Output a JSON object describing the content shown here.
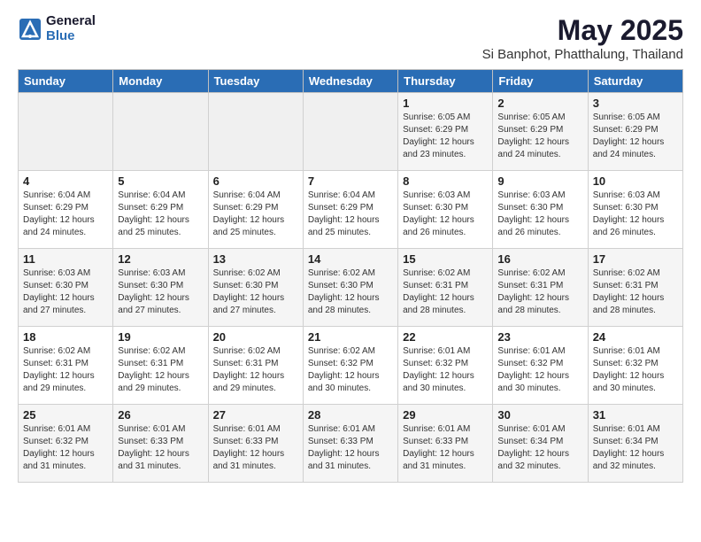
{
  "header": {
    "logo_general": "General",
    "logo_blue": "Blue",
    "month_year": "May 2025",
    "location": "Si Banphot, Phatthalung, Thailand"
  },
  "weekdays": [
    "Sunday",
    "Monday",
    "Tuesday",
    "Wednesday",
    "Thursday",
    "Friday",
    "Saturday"
  ],
  "weeks": [
    [
      {
        "num": "",
        "info": ""
      },
      {
        "num": "",
        "info": ""
      },
      {
        "num": "",
        "info": ""
      },
      {
        "num": "",
        "info": ""
      },
      {
        "num": "1",
        "info": "Sunrise: 6:05 AM\nSunset: 6:29 PM\nDaylight: 12 hours\nand 23 minutes."
      },
      {
        "num": "2",
        "info": "Sunrise: 6:05 AM\nSunset: 6:29 PM\nDaylight: 12 hours\nand 24 minutes."
      },
      {
        "num": "3",
        "info": "Sunrise: 6:05 AM\nSunset: 6:29 PM\nDaylight: 12 hours\nand 24 minutes."
      }
    ],
    [
      {
        "num": "4",
        "info": "Sunrise: 6:04 AM\nSunset: 6:29 PM\nDaylight: 12 hours\nand 24 minutes."
      },
      {
        "num": "5",
        "info": "Sunrise: 6:04 AM\nSunset: 6:29 PM\nDaylight: 12 hours\nand 25 minutes."
      },
      {
        "num": "6",
        "info": "Sunrise: 6:04 AM\nSunset: 6:29 PM\nDaylight: 12 hours\nand 25 minutes."
      },
      {
        "num": "7",
        "info": "Sunrise: 6:04 AM\nSunset: 6:29 PM\nDaylight: 12 hours\nand 25 minutes."
      },
      {
        "num": "8",
        "info": "Sunrise: 6:03 AM\nSunset: 6:30 PM\nDaylight: 12 hours\nand 26 minutes."
      },
      {
        "num": "9",
        "info": "Sunrise: 6:03 AM\nSunset: 6:30 PM\nDaylight: 12 hours\nand 26 minutes."
      },
      {
        "num": "10",
        "info": "Sunrise: 6:03 AM\nSunset: 6:30 PM\nDaylight: 12 hours\nand 26 minutes."
      }
    ],
    [
      {
        "num": "11",
        "info": "Sunrise: 6:03 AM\nSunset: 6:30 PM\nDaylight: 12 hours\nand 27 minutes."
      },
      {
        "num": "12",
        "info": "Sunrise: 6:03 AM\nSunset: 6:30 PM\nDaylight: 12 hours\nand 27 minutes."
      },
      {
        "num": "13",
        "info": "Sunrise: 6:02 AM\nSunset: 6:30 PM\nDaylight: 12 hours\nand 27 minutes."
      },
      {
        "num": "14",
        "info": "Sunrise: 6:02 AM\nSunset: 6:30 PM\nDaylight: 12 hours\nand 28 minutes."
      },
      {
        "num": "15",
        "info": "Sunrise: 6:02 AM\nSunset: 6:31 PM\nDaylight: 12 hours\nand 28 minutes."
      },
      {
        "num": "16",
        "info": "Sunrise: 6:02 AM\nSunset: 6:31 PM\nDaylight: 12 hours\nand 28 minutes."
      },
      {
        "num": "17",
        "info": "Sunrise: 6:02 AM\nSunset: 6:31 PM\nDaylight: 12 hours\nand 28 minutes."
      }
    ],
    [
      {
        "num": "18",
        "info": "Sunrise: 6:02 AM\nSunset: 6:31 PM\nDaylight: 12 hours\nand 29 minutes."
      },
      {
        "num": "19",
        "info": "Sunrise: 6:02 AM\nSunset: 6:31 PM\nDaylight: 12 hours\nand 29 minutes."
      },
      {
        "num": "20",
        "info": "Sunrise: 6:02 AM\nSunset: 6:31 PM\nDaylight: 12 hours\nand 29 minutes."
      },
      {
        "num": "21",
        "info": "Sunrise: 6:02 AM\nSunset: 6:32 PM\nDaylight: 12 hours\nand 30 minutes."
      },
      {
        "num": "22",
        "info": "Sunrise: 6:01 AM\nSunset: 6:32 PM\nDaylight: 12 hours\nand 30 minutes."
      },
      {
        "num": "23",
        "info": "Sunrise: 6:01 AM\nSunset: 6:32 PM\nDaylight: 12 hours\nand 30 minutes."
      },
      {
        "num": "24",
        "info": "Sunrise: 6:01 AM\nSunset: 6:32 PM\nDaylight: 12 hours\nand 30 minutes."
      }
    ],
    [
      {
        "num": "25",
        "info": "Sunrise: 6:01 AM\nSunset: 6:32 PM\nDaylight: 12 hours\nand 31 minutes."
      },
      {
        "num": "26",
        "info": "Sunrise: 6:01 AM\nSunset: 6:33 PM\nDaylight: 12 hours\nand 31 minutes."
      },
      {
        "num": "27",
        "info": "Sunrise: 6:01 AM\nSunset: 6:33 PM\nDaylight: 12 hours\nand 31 minutes."
      },
      {
        "num": "28",
        "info": "Sunrise: 6:01 AM\nSunset: 6:33 PM\nDaylight: 12 hours\nand 31 minutes."
      },
      {
        "num": "29",
        "info": "Sunrise: 6:01 AM\nSunset: 6:33 PM\nDaylight: 12 hours\nand 31 minutes."
      },
      {
        "num": "30",
        "info": "Sunrise: 6:01 AM\nSunset: 6:34 PM\nDaylight: 12 hours\nand 32 minutes."
      },
      {
        "num": "31",
        "info": "Sunrise: 6:01 AM\nSunset: 6:34 PM\nDaylight: 12 hours\nand 32 minutes."
      }
    ]
  ]
}
